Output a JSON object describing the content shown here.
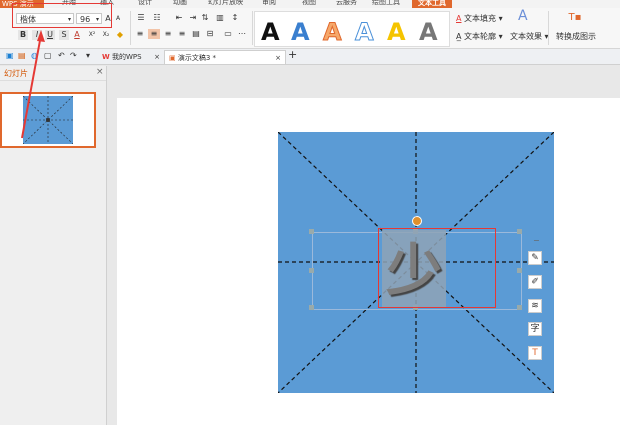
{
  "menubar": {
    "app_label": "WPS 演示",
    "tabs": [
      "开始",
      "插入",
      "设计",
      "动画",
      "幻灯片放映",
      "审阅",
      "视图",
      "云服务",
      "绘图工具",
      "文本工具"
    ]
  },
  "ribbon": {
    "font_name": "楷体",
    "font_size": "96",
    "bold": "B",
    "italic": "I",
    "underline": "U",
    "shadow": "S",
    "font_color": "A",
    "superscript": "X²",
    "subscript": "X₂",
    "text_fill": "文本填充",
    "text_outline": "文本轮廓",
    "text_effect": "文本效果",
    "convert": "转换成图示",
    "art_letter": "A"
  },
  "docbar": {
    "my_wps": "我的WPS",
    "doc_title": "演示文稿3 *",
    "add": "+"
  },
  "left_panel": {
    "title": "幻灯片",
    "close": "×",
    "slide_number": "1"
  },
  "slide": {
    "character": "少"
  },
  "colors": {
    "accent": "#e0682d",
    "slide_bg": "#5b9bd5",
    "highlight": "#e53935"
  }
}
